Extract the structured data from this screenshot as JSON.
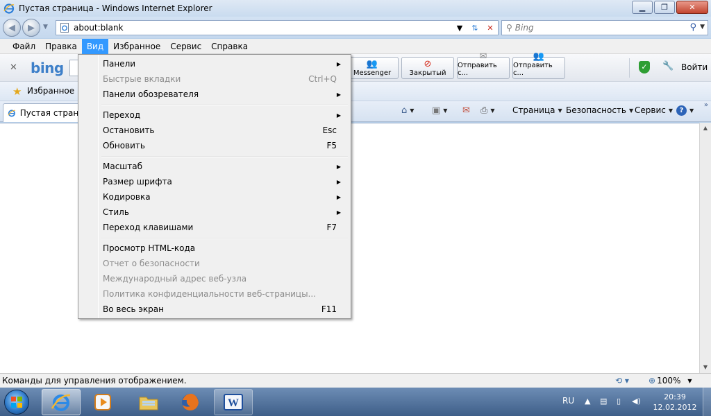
{
  "window": {
    "title": "Пустая страница - Windows Internet Explorer",
    "minimize": "▁",
    "maximize": "❐",
    "close": "✕"
  },
  "nav": {
    "back": "◀",
    "forward": "▶",
    "address": "about:blank",
    "search_placeholder": "Bing"
  },
  "menubar": {
    "file": "Файл",
    "edit": "Правка",
    "view": "Вид",
    "favorites": "Избранное",
    "tools": "Сервис",
    "help": "Справка"
  },
  "bing_toolbar": {
    "logo": "bing",
    "buttons": [
      {
        "label": "Messenger",
        "icon": "messenger-icon"
      },
      {
        "label": "Закрытый",
        "icon": "no-entry-icon"
      },
      {
        "label": "Отправить с...",
        "icon": "mail-icon"
      },
      {
        "label": "Отправить с...",
        "icon": "mail-icon"
      }
    ],
    "login": "Войти"
  },
  "favorites_bar": {
    "label": "Избранное"
  },
  "tab": {
    "title": "Пустая страница"
  },
  "command_bar": {
    "page": "Страница",
    "safety": "Безопасность",
    "tools": "Сервис"
  },
  "view_menu": {
    "items": [
      {
        "label": "Панели",
        "shortcut": "",
        "submenu": true,
        "disabled": false
      },
      {
        "label": "Быстрые вкладки",
        "shortcut": "Ctrl+Q",
        "submenu": false,
        "disabled": true
      },
      {
        "label": "Панели обозревателя",
        "shortcut": "",
        "submenu": true,
        "disabled": false
      },
      {
        "label": "Переход",
        "shortcut": "",
        "submenu": true,
        "disabled": false
      },
      {
        "label": "Остановить",
        "shortcut": "Esc",
        "submenu": false,
        "disabled": false
      },
      {
        "label": "Обновить",
        "shortcut": "F5",
        "submenu": false,
        "disabled": false
      },
      {
        "label": "Масштаб",
        "shortcut": "",
        "submenu": true,
        "disabled": false
      },
      {
        "label": "Размер шрифта",
        "shortcut": "",
        "submenu": true,
        "disabled": false
      },
      {
        "label": "Кодировка",
        "shortcut": "",
        "submenu": true,
        "disabled": false
      },
      {
        "label": "Стиль",
        "shortcut": "",
        "submenu": true,
        "disabled": false
      },
      {
        "label": "Переход клавишами",
        "shortcut": "F7",
        "submenu": false,
        "disabled": false
      },
      {
        "label": "Просмотр HTML-кода",
        "shortcut": "",
        "submenu": false,
        "disabled": false
      },
      {
        "label": "Отчет о безопасности",
        "shortcut": "",
        "submenu": false,
        "disabled": true
      },
      {
        "label": "Международный адрес веб-узла",
        "shortcut": "",
        "submenu": false,
        "disabled": true
      },
      {
        "label": "Политика конфиденциальности веб-страницы...",
        "shortcut": "",
        "submenu": false,
        "disabled": true
      },
      {
        "label": "Во весь экран",
        "shortcut": "F11",
        "submenu": false,
        "disabled": false
      }
    ]
  },
  "status": {
    "text": "Команды для управления отображением.",
    "zoom": "100%"
  },
  "taskbar": {
    "language": "RU",
    "time": "20:39",
    "date": "12.02.2012",
    "apps": [
      "internet-explorer",
      "media-player",
      "file-explorer",
      "firefox",
      "word"
    ]
  },
  "colors": {
    "menu_highlight": "#3399ff",
    "disabled_text": "#8b8b8b",
    "taskbar": "#4a6a94"
  }
}
